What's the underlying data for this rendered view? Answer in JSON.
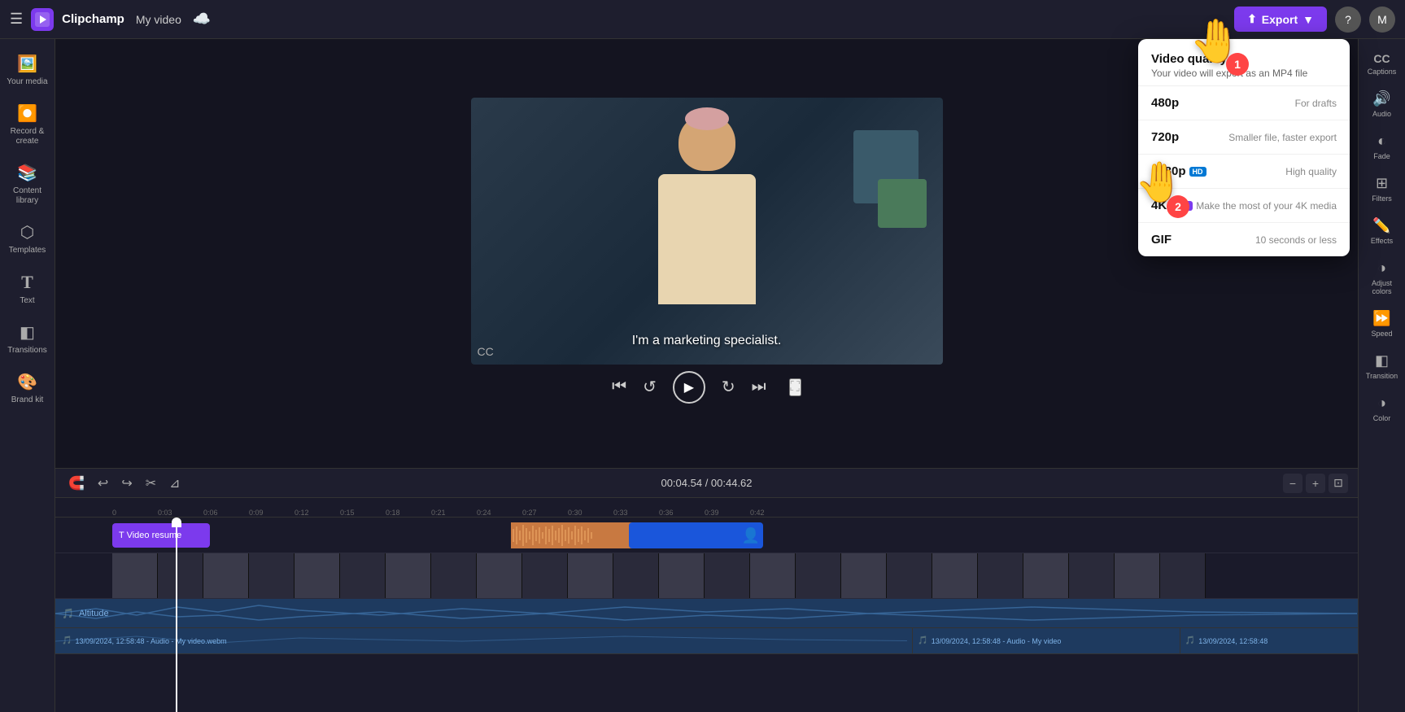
{
  "app": {
    "name": "Clipchamp",
    "video_title": "My video",
    "export_label": "Export"
  },
  "left_sidebar": {
    "items": [
      {
        "id": "your-media",
        "icon": "🖼️",
        "label": "Your media"
      },
      {
        "id": "record-create",
        "icon": "⏺️",
        "label": "Record & create"
      },
      {
        "id": "content-library",
        "icon": "📚",
        "label": "Content library"
      },
      {
        "id": "templates",
        "icon": "⬡",
        "label": "Templates"
      },
      {
        "id": "text",
        "icon": "T",
        "label": "Text"
      },
      {
        "id": "transitions",
        "icon": "✦",
        "label": "Transitions"
      },
      {
        "id": "brand-kit",
        "icon": "🎨",
        "label": "Brand kit"
      }
    ]
  },
  "right_sidebar": {
    "items": [
      {
        "id": "captions",
        "icon": "CC",
        "label": "Captions"
      },
      {
        "id": "audio",
        "icon": "🔊",
        "label": "Audio"
      },
      {
        "id": "fade",
        "icon": "◐",
        "label": "Fade"
      },
      {
        "id": "filters",
        "icon": "⊞",
        "label": "Filters"
      },
      {
        "id": "effects",
        "icon": "✏️",
        "label": "Effects"
      },
      {
        "id": "adjust-colors",
        "icon": "◑",
        "label": "Adjust colors"
      },
      {
        "id": "speed",
        "icon": "⏩",
        "label": "Speed"
      },
      {
        "id": "transition",
        "icon": "◧",
        "label": "Transition"
      },
      {
        "id": "color",
        "icon": "◑",
        "label": "Color"
      }
    ]
  },
  "video_player": {
    "subtitle": "I'm a marketing specialist.",
    "time_current": "00:04.54",
    "time_total": "00:44.62"
  },
  "quality_dropdown": {
    "title": "Video quality",
    "subtitle": "Your video will export as an MP4 file",
    "options": [
      {
        "id": "480p",
        "name": "480p",
        "badge": null,
        "desc": "For drafts"
      },
      {
        "id": "720p",
        "name": "720p",
        "badge": null,
        "desc": "Smaller file, faster export"
      },
      {
        "id": "1080p",
        "name": "1080p",
        "badge": "HD",
        "badge_class": "badge-hd",
        "desc": "High quality"
      },
      {
        "id": "4k",
        "name": "4K",
        "badge": "UHD",
        "badge_class": "badge-uhd",
        "desc": "Make the most of your 4K media"
      },
      {
        "id": "gif",
        "name": "GIF",
        "badge": null,
        "desc": "10 seconds or less"
      }
    ]
  },
  "timeline": {
    "time_display": "00:04.54 / 00:44.62",
    "tracks": [
      {
        "id": "text-track",
        "label": "",
        "clip": "Video resume"
      },
      {
        "id": "audio-track-1",
        "label": "",
        "clip": "Altitude"
      },
      {
        "id": "audio-track-2",
        "label": "",
        "clip": "13/09/2024, 12:58:48 - Audio - My video.webm"
      }
    ],
    "ruler_marks": [
      "0:00",
      "0:03",
      "0:06",
      "0:09",
      "0:12",
      "0:15",
      "0:18",
      "0:21",
      "0:24",
      "0:27",
      "0:30",
      "0:33",
      "0:36",
      "0:39",
      "0:42"
    ]
  }
}
